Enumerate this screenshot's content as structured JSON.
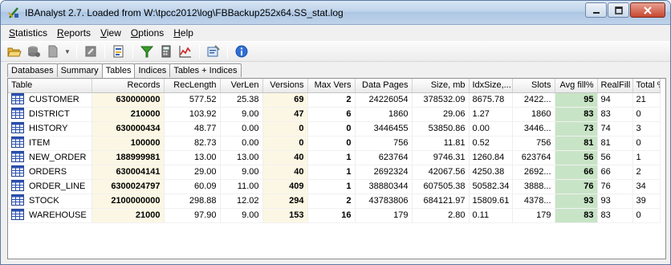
{
  "window": {
    "title": "IBAnalyst 2.7. Loaded from W:\\tpcc2012\\log\\FBBackup252x64.SS_stat.log"
  },
  "menu": [
    {
      "label": "Statistics",
      "accel": "S",
      "rest": "tatistics"
    },
    {
      "label": "Reports",
      "accel": "R",
      "rest": "eports"
    },
    {
      "label": "View",
      "accel": "V",
      "rest": "iew"
    },
    {
      "label": "Options",
      "accel": "O",
      "rest": "ptions"
    },
    {
      "label": "Help",
      "accel": "H",
      "rest": "elp"
    }
  ],
  "toolbar_icons": [
    "open-folder-icon",
    "database-icon",
    "document-icon",
    "dropdown-arrow-icon",
    "export-icon",
    "report-icon",
    "filter-icon",
    "calculator-icon",
    "chart-icon",
    "properties-icon",
    "info-icon"
  ],
  "tabs": [
    "Databases",
    "Summary",
    "Tables",
    "Indices",
    "Tables + Indices"
  ],
  "active_tab": "Tables",
  "table": {
    "headers": [
      "Table",
      "Records",
      "RecLength",
      "VerLen",
      "Versions",
      "Max Vers",
      "Data Pages",
      "Size, mb",
      "IdxSize,...",
      "Slots",
      "Avg fill%",
      "RealFill",
      "Total %"
    ],
    "rows": [
      {
        "name": "CUSTOMER",
        "records": "630000000",
        "reclength": "577.52",
        "verlen": "25.38",
        "versions": "69",
        "maxvers": "2",
        "datapages": "24226054",
        "size": "378532.09",
        "idxsize": "8675.78",
        "slots": "2422...",
        "avgfill": "95",
        "realfill": "94",
        "total": "21"
      },
      {
        "name": "DISTRICT",
        "records": "210000",
        "reclength": "103.92",
        "verlen": "9.00",
        "versions": "47",
        "maxvers": "6",
        "datapages": "1860",
        "size": "29.06",
        "idxsize": "1.27",
        "slots": "1860",
        "avgfill": "83",
        "realfill": "83",
        "total": "0"
      },
      {
        "name": "HISTORY",
        "records": "630000434",
        "reclength": "48.77",
        "verlen": "0.00",
        "versions": "0",
        "maxvers": "0",
        "datapages": "3446455",
        "size": "53850.86",
        "idxsize": "0.00",
        "slots": "3446...",
        "avgfill": "73",
        "realfill": "74",
        "total": "3"
      },
      {
        "name": "ITEM",
        "records": "100000",
        "reclength": "82.73",
        "verlen": "0.00",
        "versions": "0",
        "maxvers": "0",
        "datapages": "756",
        "size": "11.81",
        "idxsize": "0.52",
        "slots": "756",
        "avgfill": "81",
        "realfill": "81",
        "total": "0"
      },
      {
        "name": "NEW_ORDER",
        "records": "188999981",
        "reclength": "13.00",
        "verlen": "13.00",
        "versions": "40",
        "maxvers": "1",
        "datapages": "623764",
        "size": "9746.31",
        "idxsize": "1260.84",
        "slots": "623764",
        "avgfill": "56",
        "realfill": "56",
        "total": "1"
      },
      {
        "name": "ORDERS",
        "records": "630004141",
        "reclength": "29.00",
        "verlen": "9.00",
        "versions": "40",
        "maxvers": "1",
        "datapages": "2692324",
        "size": "42067.56",
        "idxsize": "4250.38",
        "slots": "2692...",
        "avgfill": "66",
        "realfill": "66",
        "total": "2"
      },
      {
        "name": "ORDER_LINE",
        "records": "6300024797",
        "reclength": "60.09",
        "verlen": "11.00",
        "versions": "409",
        "maxvers": "1",
        "datapages": "38880344",
        "size": "607505.38",
        "idxsize": "50582.34",
        "slots": "3888...",
        "avgfill": "76",
        "realfill": "76",
        "total": "34"
      },
      {
        "name": "STOCK",
        "records": "2100000000",
        "reclength": "298.88",
        "verlen": "12.02",
        "versions": "294",
        "maxvers": "2",
        "datapages": "43783806",
        "size": "684121.97",
        "idxsize": "15809.61",
        "slots": "4378...",
        "avgfill": "93",
        "realfill": "93",
        "total": "39"
      },
      {
        "name": "WAREHOUSE",
        "records": "21000",
        "reclength": "97.90",
        "verlen": "9.00",
        "versions": "153",
        "maxvers": "16",
        "datapages": "179",
        "size": "2.80",
        "idxsize": "0.11",
        "slots": "179",
        "avgfill": "83",
        "realfill": "83",
        "total": "0"
      }
    ]
  },
  "colors": {
    "records_bg": "#fcf7e4",
    "fill_bg": "#c8e4c6",
    "titlebar": "#bed3ea"
  }
}
